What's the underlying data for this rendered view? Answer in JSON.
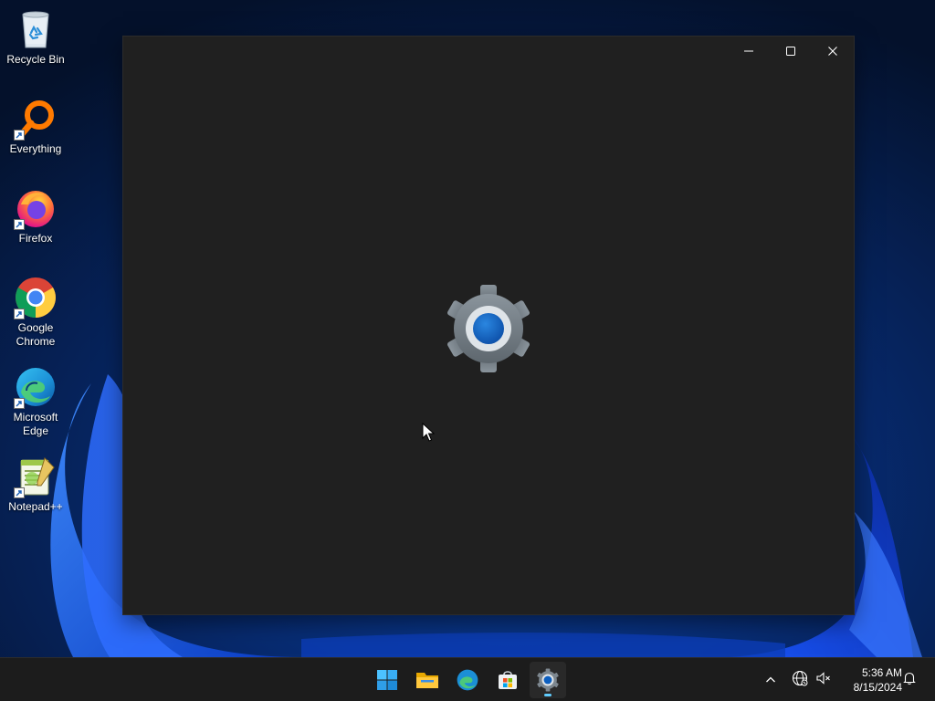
{
  "desktop": {
    "icons": [
      {
        "label": "Recycle Bin",
        "icon": "recycle-bin-icon"
      },
      {
        "label": "Everything",
        "icon": "everything-search-icon"
      },
      {
        "label": "Firefox",
        "icon": "firefox-icon"
      },
      {
        "label": "Google\nChrome",
        "icon": "chrome-icon"
      },
      {
        "label": "Microsoft\nEdge",
        "icon": "edge-icon"
      },
      {
        "label": "Notepad++",
        "icon": "notepad-plus-plus-icon"
      }
    ]
  },
  "window": {
    "app": "Settings",
    "splash_icon": "settings-gear-icon",
    "background": "#202020",
    "controls": {
      "minimize": "minimize-icon",
      "maximize": "maximize-icon",
      "close": "close-icon"
    }
  },
  "taskbar": {
    "background": "#1c1c1c",
    "apps": [
      {
        "name": "Start",
        "icon": "windows-start-icon"
      },
      {
        "name": "File Explorer",
        "icon": "file-explorer-icon"
      },
      {
        "name": "Microsoft Edge",
        "icon": "edge-icon"
      },
      {
        "name": "Microsoft Store",
        "icon": "store-icon"
      },
      {
        "name": "Settings",
        "icon": "settings-gear-icon",
        "active": true
      }
    ],
    "tray": {
      "overflow_icon": "chevron-up-icon",
      "network_icon": "globe-network-icon",
      "volume_icon": "speaker-muted-icon",
      "notification_icon": "bell-icon"
    },
    "clock": {
      "time": "5:36 AM",
      "date": "8/15/2024"
    }
  },
  "colors": {
    "accent": "#0067c0",
    "indicator": "#60cdff"
  }
}
